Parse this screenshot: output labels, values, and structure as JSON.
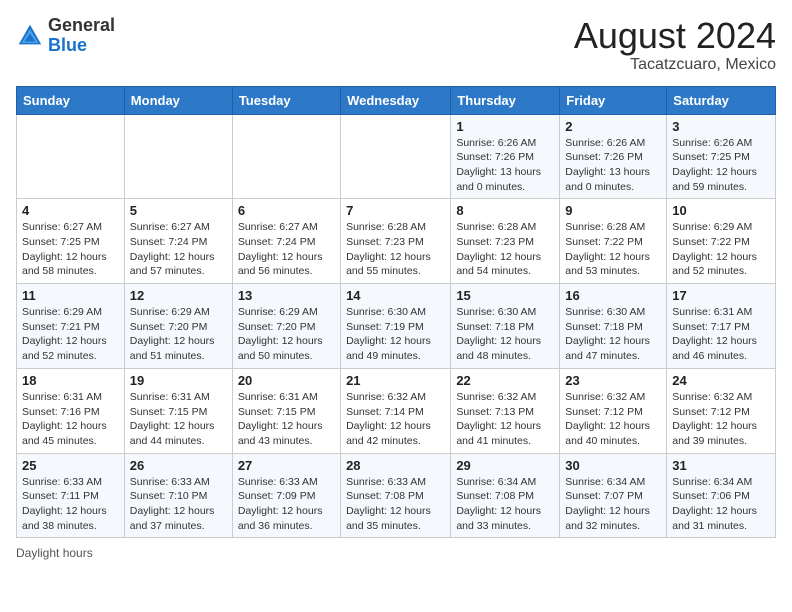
{
  "header": {
    "logo_general": "General",
    "logo_blue": "Blue",
    "month_year": "August 2024",
    "location": "Tacatzcuaro, Mexico"
  },
  "days_of_week": [
    "Sunday",
    "Monday",
    "Tuesday",
    "Wednesday",
    "Thursday",
    "Friday",
    "Saturday"
  ],
  "footer_text": "Daylight hours",
  "weeks": [
    [
      {
        "day": "",
        "info": ""
      },
      {
        "day": "",
        "info": ""
      },
      {
        "day": "",
        "info": ""
      },
      {
        "day": "",
        "info": ""
      },
      {
        "day": "1",
        "info": "Sunrise: 6:26 AM\nSunset: 7:26 PM\nDaylight: 13 hours\nand 0 minutes."
      },
      {
        "day": "2",
        "info": "Sunrise: 6:26 AM\nSunset: 7:26 PM\nDaylight: 13 hours\nand 0 minutes."
      },
      {
        "day": "3",
        "info": "Sunrise: 6:26 AM\nSunset: 7:25 PM\nDaylight: 12 hours\nand 59 minutes."
      }
    ],
    [
      {
        "day": "4",
        "info": "Sunrise: 6:27 AM\nSunset: 7:25 PM\nDaylight: 12 hours\nand 58 minutes."
      },
      {
        "day": "5",
        "info": "Sunrise: 6:27 AM\nSunset: 7:24 PM\nDaylight: 12 hours\nand 57 minutes."
      },
      {
        "day": "6",
        "info": "Sunrise: 6:27 AM\nSunset: 7:24 PM\nDaylight: 12 hours\nand 56 minutes."
      },
      {
        "day": "7",
        "info": "Sunrise: 6:28 AM\nSunset: 7:23 PM\nDaylight: 12 hours\nand 55 minutes."
      },
      {
        "day": "8",
        "info": "Sunrise: 6:28 AM\nSunset: 7:23 PM\nDaylight: 12 hours\nand 54 minutes."
      },
      {
        "day": "9",
        "info": "Sunrise: 6:28 AM\nSunset: 7:22 PM\nDaylight: 12 hours\nand 53 minutes."
      },
      {
        "day": "10",
        "info": "Sunrise: 6:29 AM\nSunset: 7:22 PM\nDaylight: 12 hours\nand 52 minutes."
      }
    ],
    [
      {
        "day": "11",
        "info": "Sunrise: 6:29 AM\nSunset: 7:21 PM\nDaylight: 12 hours\nand 52 minutes."
      },
      {
        "day": "12",
        "info": "Sunrise: 6:29 AM\nSunset: 7:20 PM\nDaylight: 12 hours\nand 51 minutes."
      },
      {
        "day": "13",
        "info": "Sunrise: 6:29 AM\nSunset: 7:20 PM\nDaylight: 12 hours\nand 50 minutes."
      },
      {
        "day": "14",
        "info": "Sunrise: 6:30 AM\nSunset: 7:19 PM\nDaylight: 12 hours\nand 49 minutes."
      },
      {
        "day": "15",
        "info": "Sunrise: 6:30 AM\nSunset: 7:18 PM\nDaylight: 12 hours\nand 48 minutes."
      },
      {
        "day": "16",
        "info": "Sunrise: 6:30 AM\nSunset: 7:18 PM\nDaylight: 12 hours\nand 47 minutes."
      },
      {
        "day": "17",
        "info": "Sunrise: 6:31 AM\nSunset: 7:17 PM\nDaylight: 12 hours\nand 46 minutes."
      }
    ],
    [
      {
        "day": "18",
        "info": "Sunrise: 6:31 AM\nSunset: 7:16 PM\nDaylight: 12 hours\nand 45 minutes."
      },
      {
        "day": "19",
        "info": "Sunrise: 6:31 AM\nSunset: 7:15 PM\nDaylight: 12 hours\nand 44 minutes."
      },
      {
        "day": "20",
        "info": "Sunrise: 6:31 AM\nSunset: 7:15 PM\nDaylight: 12 hours\nand 43 minutes."
      },
      {
        "day": "21",
        "info": "Sunrise: 6:32 AM\nSunset: 7:14 PM\nDaylight: 12 hours\nand 42 minutes."
      },
      {
        "day": "22",
        "info": "Sunrise: 6:32 AM\nSunset: 7:13 PM\nDaylight: 12 hours\nand 41 minutes."
      },
      {
        "day": "23",
        "info": "Sunrise: 6:32 AM\nSunset: 7:12 PM\nDaylight: 12 hours\nand 40 minutes."
      },
      {
        "day": "24",
        "info": "Sunrise: 6:32 AM\nSunset: 7:12 PM\nDaylight: 12 hours\nand 39 minutes."
      }
    ],
    [
      {
        "day": "25",
        "info": "Sunrise: 6:33 AM\nSunset: 7:11 PM\nDaylight: 12 hours\nand 38 minutes."
      },
      {
        "day": "26",
        "info": "Sunrise: 6:33 AM\nSunset: 7:10 PM\nDaylight: 12 hours\nand 37 minutes."
      },
      {
        "day": "27",
        "info": "Sunrise: 6:33 AM\nSunset: 7:09 PM\nDaylight: 12 hours\nand 36 minutes."
      },
      {
        "day": "28",
        "info": "Sunrise: 6:33 AM\nSunset: 7:08 PM\nDaylight: 12 hours\nand 35 minutes."
      },
      {
        "day": "29",
        "info": "Sunrise: 6:34 AM\nSunset: 7:08 PM\nDaylight: 12 hours\nand 33 minutes."
      },
      {
        "day": "30",
        "info": "Sunrise: 6:34 AM\nSunset: 7:07 PM\nDaylight: 12 hours\nand 32 minutes."
      },
      {
        "day": "31",
        "info": "Sunrise: 6:34 AM\nSunset: 7:06 PM\nDaylight: 12 hours\nand 31 minutes."
      }
    ]
  ]
}
